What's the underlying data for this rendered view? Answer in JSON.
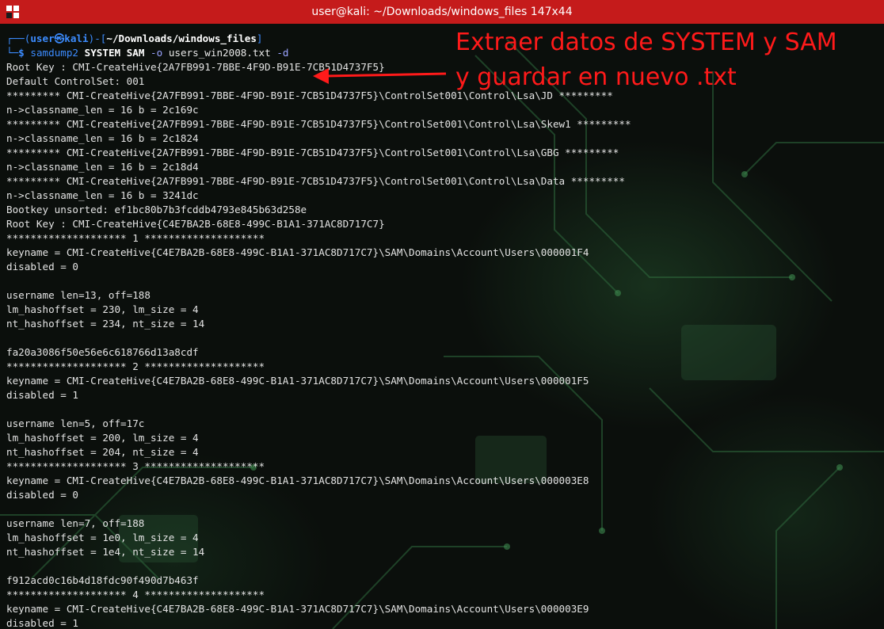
{
  "window": {
    "title": "user@kali: ~/Downloads/windows_files 147x44",
    "accent": "#c51b1b"
  },
  "icons": [
    "terminal-app-icon"
  ],
  "prompt": {
    "open": "┌──(",
    "user": "user㉿kali",
    "sep": ")-[",
    "path": "~/Downloads/windows_files",
    "close": "]",
    "prefix": "└─",
    "symbol": "$",
    "command_bin": "samdump2",
    "command_args": "SYSTEM SAM",
    "opt1": "-o",
    "file": "users_win2008.txt",
    "opt2": "-d"
  },
  "annotation": {
    "line1": "Extraer datos de SYSTEM y SAM",
    "line2": "y guardar en nuevo .txt",
    "color": "#ff1a1a"
  },
  "output": [
    "Root Key : CMI-CreateHive{2A7FB991-7BBE-4F9D-B91E-7CB51D4737F5}",
    "Default ControlSet: 001",
    "********* CMI-CreateHive{2A7FB991-7BBE-4F9D-B91E-7CB51D4737F5}\\ControlSet001\\Control\\Lsa\\JD *********",
    "n->classname_len = 16 b = 2c169c",
    "********* CMI-CreateHive{2A7FB991-7BBE-4F9D-B91E-7CB51D4737F5}\\ControlSet001\\Control\\Lsa\\Skew1 *********",
    "n->classname_len = 16 b = 2c1824",
    "********* CMI-CreateHive{2A7FB991-7BBE-4F9D-B91E-7CB51D4737F5}\\ControlSet001\\Control\\Lsa\\GBG *********",
    "n->classname_len = 16 b = 2c18d4",
    "********* CMI-CreateHive{2A7FB991-7BBE-4F9D-B91E-7CB51D4737F5}\\ControlSet001\\Control\\Lsa\\Data *********",
    "n->classname_len = 16 b = 3241dc",
    "Bootkey unsorted: ef1bc80b7b3fcddb4793e845b63d258e",
    "Root Key : CMI-CreateHive{C4E7BA2B-68E8-499C-B1A1-371AC8D717C7}",
    "******************** 1 ********************",
    "keyname = CMI-CreateHive{C4E7BA2B-68E8-499C-B1A1-371AC8D717C7}\\SAM\\Domains\\Account\\Users\\000001F4",
    "disabled = 0",
    "",
    "username len=13, off=188",
    "lm_hashoffset = 230, lm_size = 4",
    "nt_hashoffset = 234, nt_size = 14",
    "",
    "fa20a3086f50e56e6c618766d13a8cdf",
    "******************** 2 ********************",
    "keyname = CMI-CreateHive{C4E7BA2B-68E8-499C-B1A1-371AC8D717C7}\\SAM\\Domains\\Account\\Users\\000001F5",
    "disabled = 1",
    "",
    "username len=5, off=17c",
    "lm_hashoffset = 200, lm_size = 4",
    "nt_hashoffset = 204, nt_size = 4",
    "******************** 3 ********************",
    "keyname = CMI-CreateHive{C4E7BA2B-68E8-499C-B1A1-371AC8D717C7}\\SAM\\Domains\\Account\\Users\\000003E8",
    "disabled = 0",
    "",
    "username len=7, off=188",
    "lm_hashoffset = 1e0, lm_size = 4",
    "nt_hashoffset = 1e4, nt_size = 14",
    "",
    "f912acd0c16b4d18fdc90f490d7b463f",
    "******************** 4 ********************",
    "keyname = CMI-CreateHive{C4E7BA2B-68E8-499C-B1A1-371AC8D717C7}\\SAM\\Domains\\Account\\Users\\000003E9",
    "disabled = 1"
  ]
}
